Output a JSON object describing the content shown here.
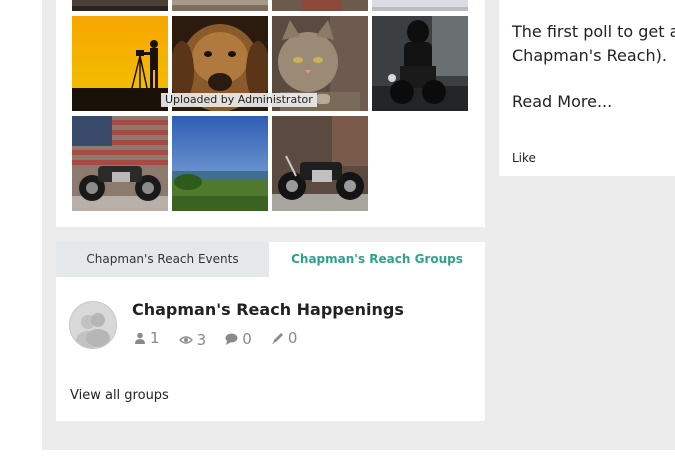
{
  "photos": {
    "caption": "Uploaded by Administrator"
  },
  "groups_section": {
    "tabs": [
      {
        "label": "Chapman's Reach Events",
        "active": false
      },
      {
        "label": "Chapman's Reach Groups",
        "active": true
      }
    ],
    "group": {
      "title": "Chapman's Reach Happenings",
      "members": "1",
      "views": "3",
      "comments": "0",
      "posts": "0"
    },
    "view_all_label": "View all groups"
  },
  "side_post": {
    "line1": "The first poll to get a fe",
    "line2": "Chapman's Reach).",
    "read_more": "Read More...",
    "like_label": "Like"
  },
  "colors": {
    "accent": "#2fa18e",
    "page_bg": "#ececec",
    "inactive_tab": "#e4e8ea"
  }
}
